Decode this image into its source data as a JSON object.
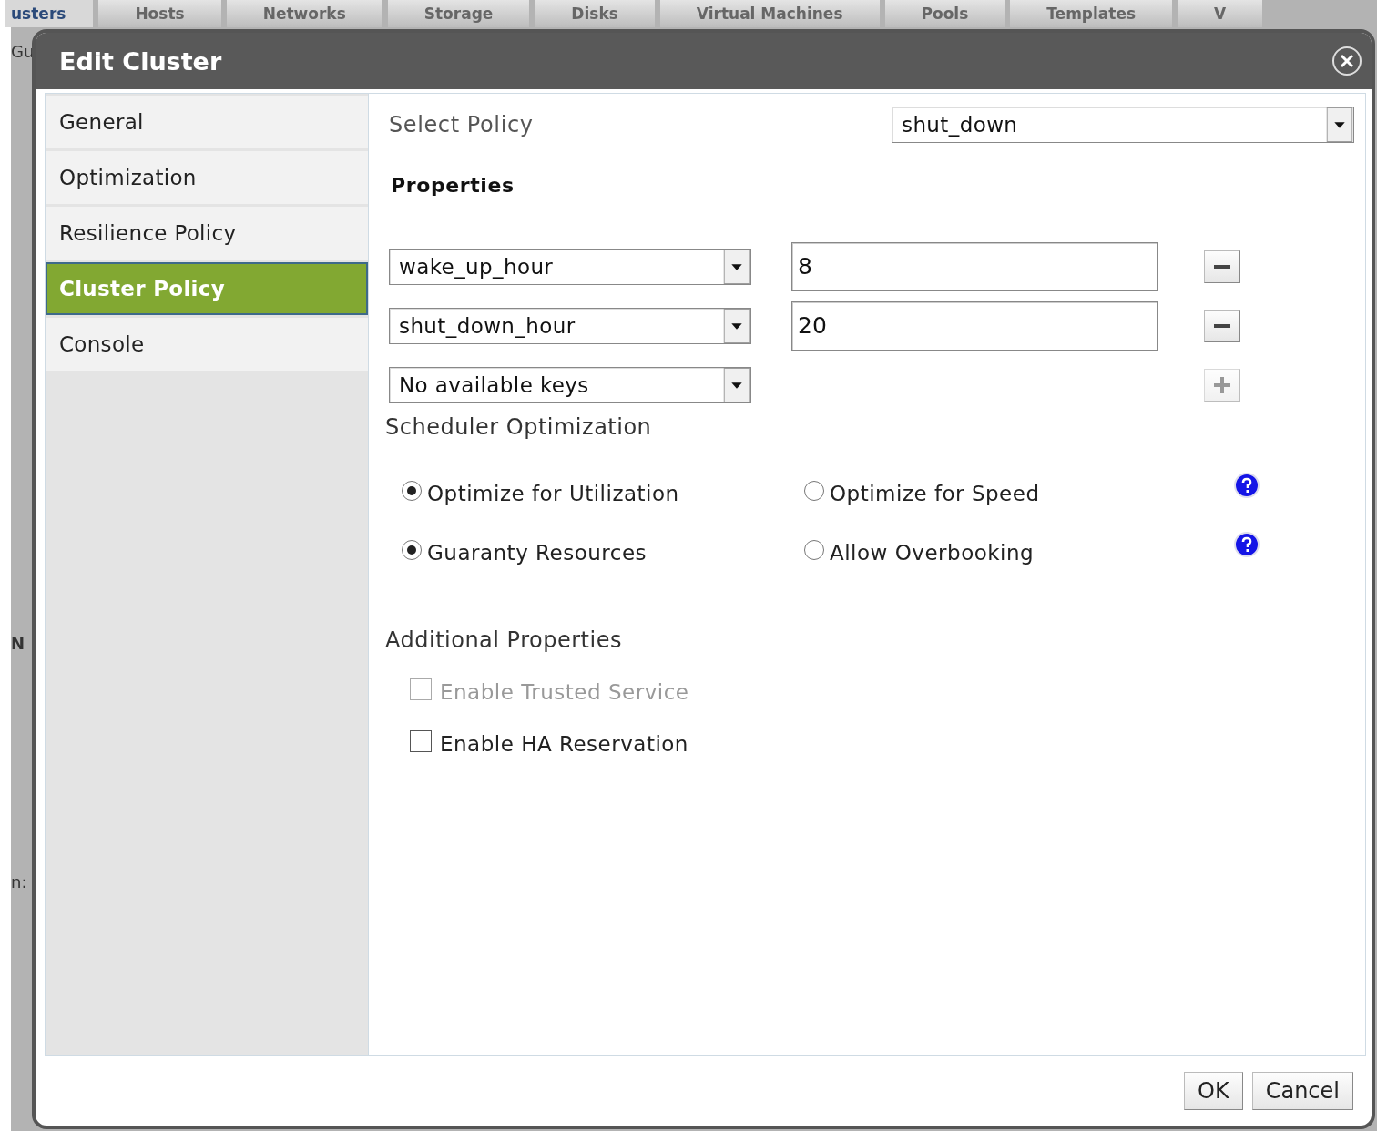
{
  "background": {
    "tabs": [
      {
        "label": "usters",
        "selected": true
      },
      {
        "label": "Hosts",
        "selected": false
      },
      {
        "label": "Networks",
        "selected": false
      },
      {
        "label": "Storage",
        "selected": false
      },
      {
        "label": "Disks",
        "selected": false
      },
      {
        "label": "Virtual Machines",
        "selected": false
      },
      {
        "label": "Pools",
        "selected": false
      },
      {
        "label": "Templates",
        "selected": false
      },
      {
        "label": "V",
        "selected": false
      }
    ],
    "fragments": [
      "Gu",
      "N",
      "n:"
    ]
  },
  "dialog": {
    "title": "Edit Cluster",
    "nav": [
      {
        "label": "General",
        "selected": false
      },
      {
        "label": "Optimization",
        "selected": false
      },
      {
        "label": "Resilience Policy",
        "selected": false
      },
      {
        "label": "Cluster Policy",
        "selected": true
      },
      {
        "label": "Console",
        "selected": false
      }
    ],
    "select_policy": {
      "label": "Select Policy",
      "value": "shut_down"
    },
    "properties": {
      "title": "Properties",
      "rows": [
        {
          "key": "wake_up_hour",
          "value": "8",
          "kind": "remove",
          "disabled": false
        },
        {
          "key": "shut_down_hour",
          "value": "20",
          "kind": "remove",
          "disabled": false
        },
        {
          "key": "No available keys",
          "kind": "add",
          "disabled": true
        }
      ]
    },
    "scheduler": {
      "title": "Scheduler Optimization",
      "groups": [
        {
          "options": [
            {
              "label": "Optimize for Utilization",
              "selected": true
            },
            {
              "label": "Optimize for Speed",
              "selected": false
            }
          ]
        },
        {
          "options": [
            {
              "label": "Guaranty Resources",
              "selected": true
            },
            {
              "label": "Allow Overbooking",
              "selected": false
            }
          ]
        }
      ]
    },
    "additional": {
      "title": "Additional Properties",
      "checkboxes": [
        {
          "label": "Enable Trusted Service",
          "checked": false,
          "disabled": true
        },
        {
          "label": "Enable HA Reservation",
          "checked": false,
          "disabled": false
        }
      ]
    },
    "buttons": [
      "OK",
      "Cancel"
    ]
  }
}
